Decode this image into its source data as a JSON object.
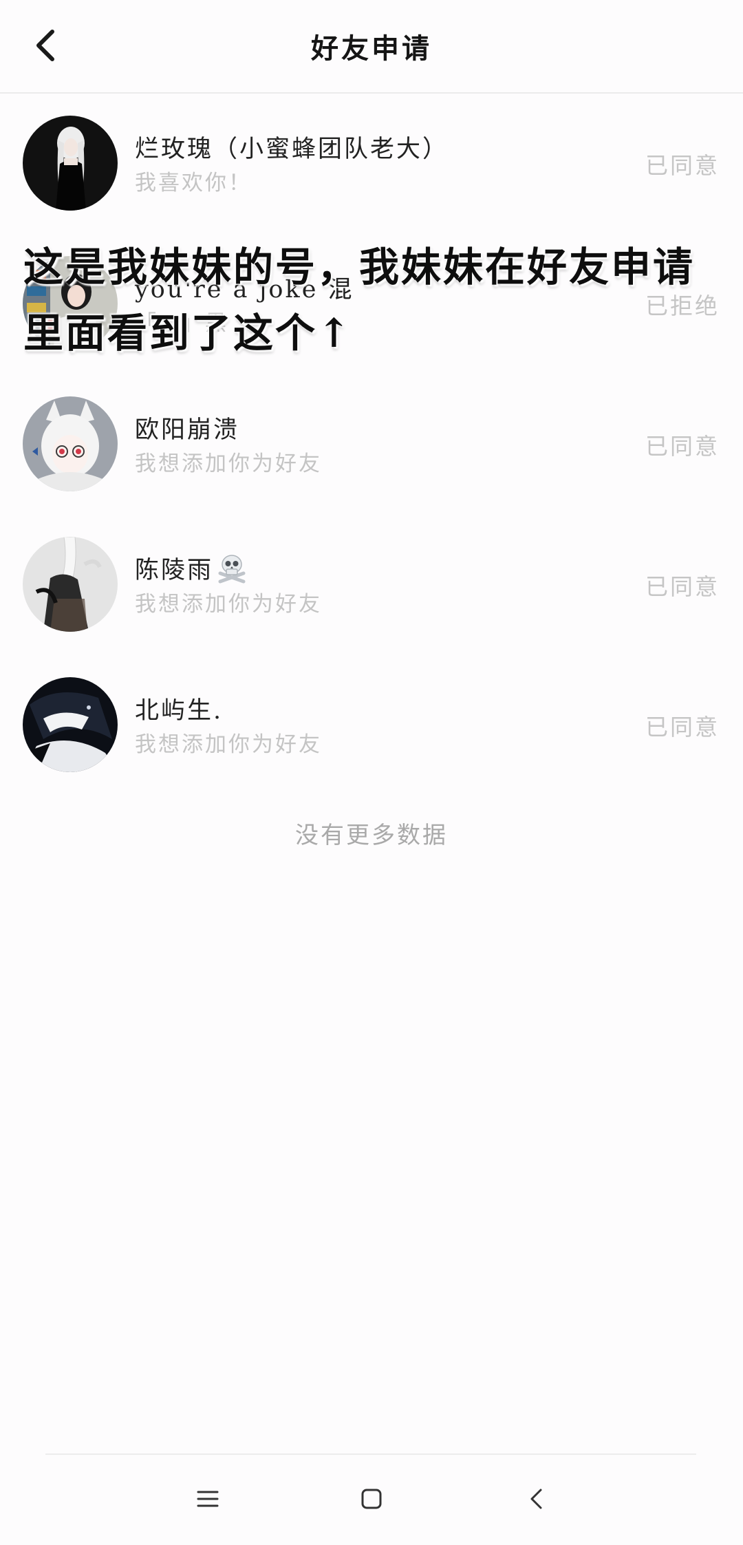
{
  "header": {
    "title": "好友申请"
  },
  "requests": [
    {
      "name": "烂玫瑰（小蜜蜂团队老大）",
      "message": "我喜欢你！",
      "status": "已同意"
    },
    {
      "name": "you're a joke 混",
      "message": "「…」黑",
      "status": "已拒绝"
    },
    {
      "name": "欧阳崩溃",
      "message": "我想添加你为好友",
      "status": "已同意"
    },
    {
      "name": "陈陵雨",
      "name_emoji": "skull-and-crossbones",
      "message": "我想添加你为好友",
      "status": "已同意"
    },
    {
      "name": "北屿生.",
      "message": "我想添加你为好友",
      "status": "已同意"
    }
  ],
  "footer_text": "没有更多数据",
  "caption": {
    "line1": "这是我妹妹的号，我妹妹在好友申请",
    "line2": "里面看到了这个↑"
  },
  "navbar": {
    "icons": [
      "menu-icon",
      "home-square-icon",
      "back-chevron-icon"
    ]
  }
}
